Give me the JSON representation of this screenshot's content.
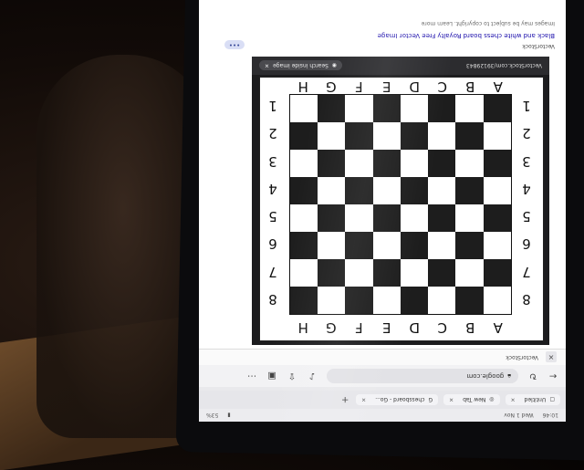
{
  "status_bar": {
    "time": "10:46",
    "date": "Wed 1 Nov",
    "battery": "53%"
  },
  "tabs": [
    {
      "label": "Untitled"
    },
    {
      "label": "New Tab"
    },
    {
      "label": "chessboard - Go..."
    }
  ],
  "toolbar": {
    "url": "google.com",
    "back_icon": "arrow-left-icon",
    "reload_icon": "reload-icon",
    "mic_icon": "mic-icon",
    "share_icon": "share-icon",
    "tabs_icon": "tabs-icon",
    "menu_icon": "more-icon"
  },
  "viewer": {
    "source_label": "VectorStock",
    "close_label": "×"
  },
  "chessboard": {
    "files_top": [
      "A",
      "B",
      "C",
      "D",
      "E",
      "F",
      "G",
      "H"
    ],
    "files_bottom": [
      "A",
      "B",
      "C",
      "D",
      "E",
      "F",
      "G",
      "H"
    ],
    "ranks_left": [
      "8",
      "7",
      "6",
      "5",
      "4",
      "3",
      "2",
      "1"
    ],
    "ranks_right": [
      "8",
      "7",
      "6",
      "5",
      "4",
      "3",
      "2",
      "1"
    ],
    "light_color": "#ffffff",
    "dark_color": "#1d1d1d"
  },
  "image_caption": {
    "search_label": "Search inside image",
    "credit": "VectorStock.com/39129843"
  },
  "result": {
    "title": "Black and white chess board Royalty Free Vector Image",
    "site": "VectorStock",
    "sub": "Images may be subject to copyright. Learn more",
    "more_label": "•••"
  }
}
